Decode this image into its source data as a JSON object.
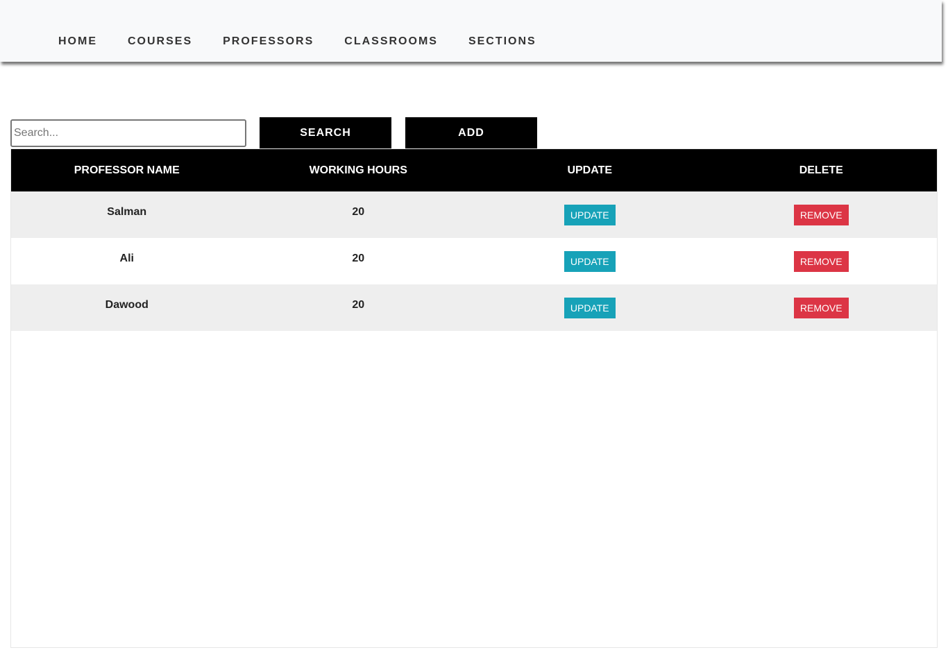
{
  "nav": {
    "items": [
      {
        "label": "HOME"
      },
      {
        "label": "COURSES"
      },
      {
        "label": "PROFESSORS"
      },
      {
        "label": "CLASSROOMS"
      },
      {
        "label": "SECTIONS"
      }
    ]
  },
  "toolbar": {
    "search_placeholder": "Search...",
    "search_value": "",
    "search_label": "SEARCH",
    "add_label": "ADD"
  },
  "table": {
    "columns": [
      "PROFESSOR NAME",
      "WORKING HOURS",
      "UPDATE",
      "DELETE"
    ],
    "rows": [
      {
        "name": "Salman",
        "hours": "20",
        "update_label": "UPDATE",
        "remove_label": "REMOVE"
      },
      {
        "name": "Ali",
        "hours": "20",
        "update_label": "UPDATE",
        "remove_label": "REMOVE"
      },
      {
        "name": "Dawood",
        "hours": "20",
        "update_label": "UPDATE",
        "remove_label": "REMOVE"
      }
    ]
  },
  "colors": {
    "nav_background": "#f8f9fa",
    "header_background": "#000000",
    "update_button": "#17a2b8",
    "remove_button": "#dc3545",
    "row_stripe": "#eeeeee"
  }
}
